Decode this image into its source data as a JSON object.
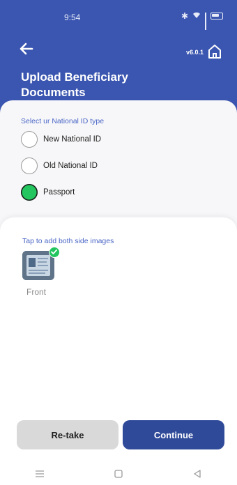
{
  "status_bar": {
    "time": "9:54"
  },
  "header": {
    "version": "v6.0.1",
    "title": "Upload Beneficiary Documents"
  },
  "id_type": {
    "label": "Select ur National ID type",
    "options": [
      {
        "label": "New National ID",
        "selected": false
      },
      {
        "label": "Old National ID",
        "selected": false
      },
      {
        "label": "Passport",
        "selected": true
      }
    ]
  },
  "upload": {
    "instruction": "Tap to add both side images",
    "front_label": "Front"
  },
  "actions": {
    "retake_label": "Re-take",
    "continue_label": "Continue"
  },
  "colors": {
    "header_bg": "#3b56b0",
    "accent_text": "#4a66c6",
    "primary_button": "#2f4a99",
    "selected_radio": "#22c55e"
  }
}
